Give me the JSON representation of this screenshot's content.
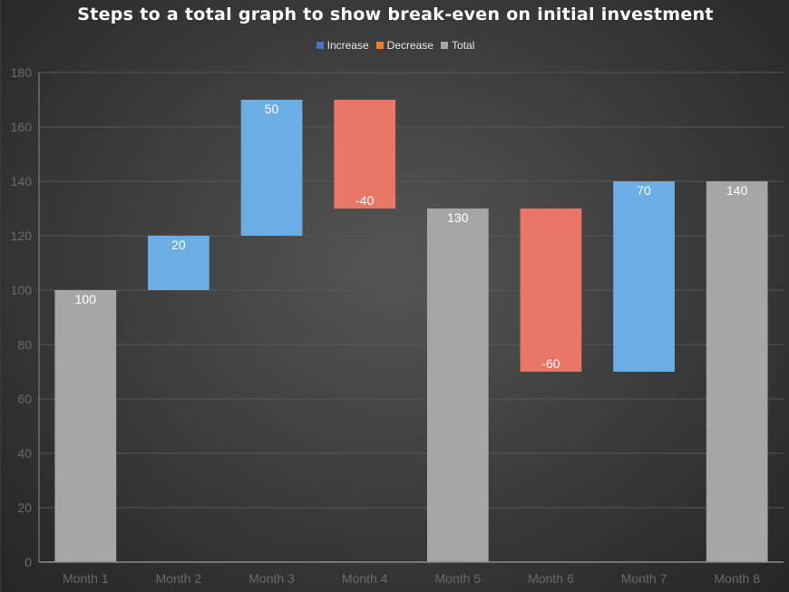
{
  "chart_data": {
    "type": "bar",
    "subtype": "waterfall",
    "title": "Steps to  a total graph to show break-even on initial investment",
    "xlabel": "",
    "ylabel": "",
    "ylim": [
      0,
      180
    ],
    "yticks": [
      0,
      20,
      40,
      60,
      80,
      100,
      120,
      140,
      160,
      180
    ],
    "grid": true,
    "legend_position": "top-center",
    "categories": [
      "Month 1",
      "Month 2",
      "Month 3",
      "Month 4",
      "Month 5",
      "Month 6",
      "Month 7",
      "Month 8"
    ],
    "legend": [
      {
        "name": "Increase",
        "color": "#4472c4"
      },
      {
        "name": "Decrease",
        "color": "#ed7d31"
      },
      {
        "name": "Total",
        "color": "#a5a5a5"
      }
    ],
    "bars": [
      {
        "category": "Month 1",
        "kind": "Total",
        "value": 100,
        "start": 0,
        "end": 100,
        "label": "100"
      },
      {
        "category": "Month 2",
        "kind": "Increase",
        "value": 20,
        "start": 100,
        "end": 120,
        "label": "20"
      },
      {
        "category": "Month 3",
        "kind": "Increase",
        "value": 50,
        "start": 120,
        "end": 170,
        "label": "50"
      },
      {
        "category": "Month 4",
        "kind": "Decrease",
        "value": -40,
        "start": 170,
        "end": 130,
        "label": "-40"
      },
      {
        "category": "Month 5",
        "kind": "Total",
        "value": 130,
        "start": 0,
        "end": 130,
        "label": "130"
      },
      {
        "category": "Month 6",
        "kind": "Decrease",
        "value": -60,
        "start": 130,
        "end": 70,
        "label": "-60"
      },
      {
        "category": "Month 7",
        "kind": "Increase",
        "value": 70,
        "start": 70,
        "end": 140,
        "label": "70"
      },
      {
        "category": "Month 8",
        "kind": "Total",
        "value": 140,
        "start": 0,
        "end": 140,
        "label": "140"
      }
    ],
    "bar_colors": {
      "Increase": "#6aaee4",
      "Decrease": "#ea7766",
      "Total": "#a6a6a6"
    }
  }
}
